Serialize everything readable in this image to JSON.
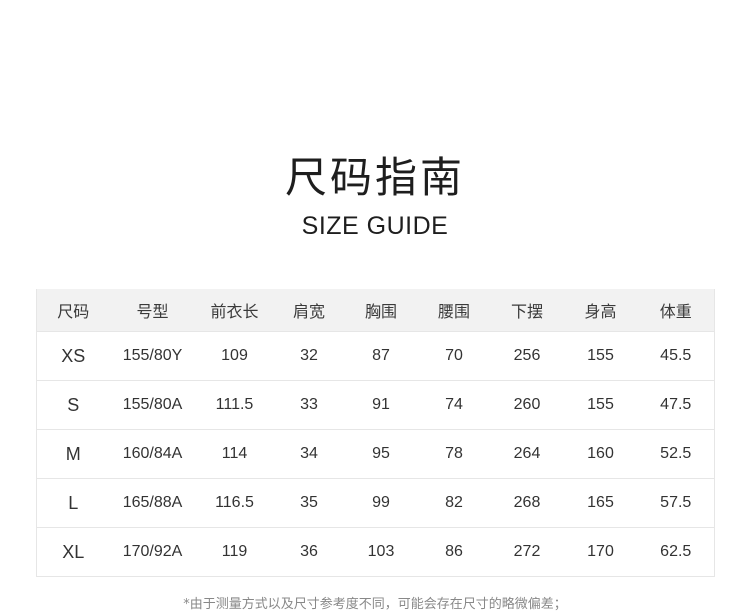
{
  "title_cn": "尺码指南",
  "title_en": "SIZE GUIDE",
  "table": {
    "headers": [
      "尺码",
      "号型",
      "前衣长",
      "肩宽",
      "胸围",
      "腰围",
      "下摆",
      "身高",
      "体重"
    ],
    "rows": [
      [
        "XS",
        "155/80Y",
        "109",
        "32",
        "87",
        "70",
        "256",
        "155",
        "45.5"
      ],
      [
        "S",
        "155/80A",
        "111.5",
        "33",
        "91",
        "74",
        "260",
        "155",
        "47.5"
      ],
      [
        "M",
        "160/84A",
        "114",
        "34",
        "95",
        "78",
        "264",
        "160",
        "52.5"
      ],
      [
        "L",
        "165/88A",
        "116.5",
        "35",
        "99",
        "82",
        "268",
        "165",
        "57.5"
      ],
      [
        "XL",
        "170/92A",
        "119",
        "36",
        "103",
        "86",
        "272",
        "170",
        "62.5"
      ]
    ]
  },
  "note": "*由于测量方式以及尺寸参考度不同，可能会存在尺寸的略微偏差；"
}
